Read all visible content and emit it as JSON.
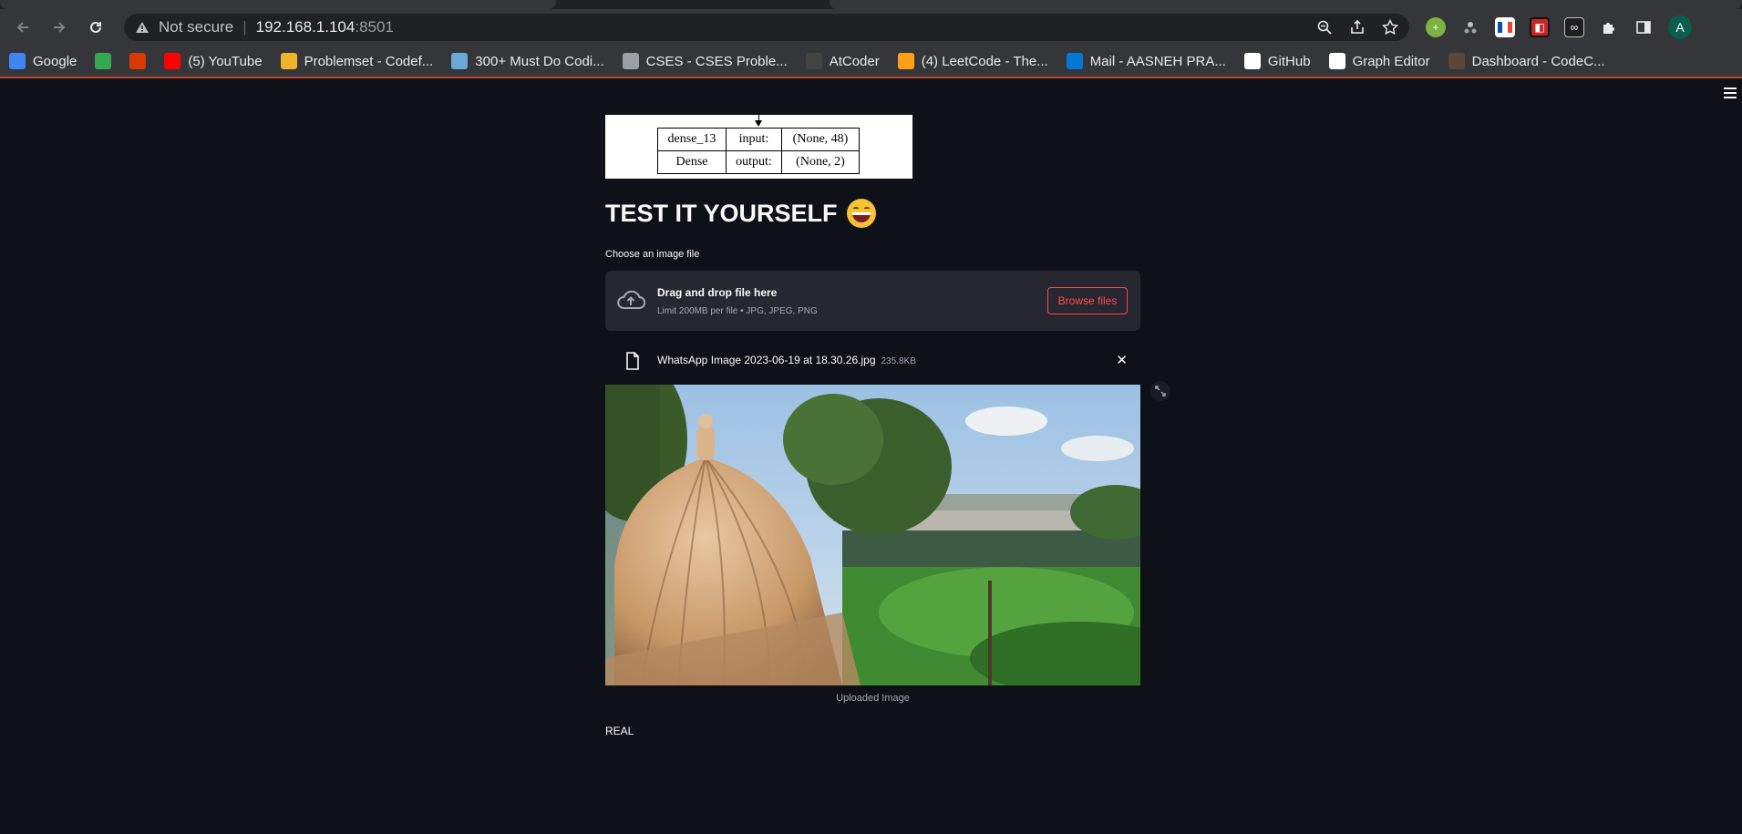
{
  "browser": {
    "security_label": "Not secure",
    "url_host": "192.168.1.104",
    "url_port": ":8501",
    "profile_initial": "A"
  },
  "bookmarks": [
    {
      "label": "Google",
      "icon": "google-icon",
      "color": "#4285f4"
    },
    {
      "label": "",
      "icon": "drive-icon",
      "color": "#34a853"
    },
    {
      "label": "",
      "icon": "office-icon",
      "color": "#d83b01"
    },
    {
      "label": "(5) YouTube",
      "icon": "youtube-icon",
      "color": "#ff0000"
    },
    {
      "label": "Problemset - Codef...",
      "icon": "codeforces-icon",
      "color": "#f0b429"
    },
    {
      "label": "300+ Must Do Codi...",
      "icon": "mountain-icon",
      "color": "#6aa9d8"
    },
    {
      "label": "CSES - CSES Proble...",
      "icon": "globe-icon",
      "color": "#9aa0a6"
    },
    {
      "label": "AtCoder",
      "icon": "atcoder-icon",
      "color": "#444444"
    },
    {
      "label": "(4) LeetCode - The...",
      "icon": "leetcode-icon",
      "color": "#ffa116"
    },
    {
      "label": "Mail - AASNEH PRA...",
      "icon": "outlook-icon",
      "color": "#0078d4"
    },
    {
      "label": "GitHub",
      "icon": "github-icon",
      "color": "#ffffff"
    },
    {
      "label": "Graph Editor",
      "icon": "graph-icon",
      "color": "#ffffff"
    },
    {
      "label": "Dashboard - CodeC...",
      "icon": "codechef-icon",
      "color": "#5b4638"
    }
  ],
  "model": {
    "layer_name": "dense_13",
    "layer_type": "Dense",
    "input_label": "input:",
    "output_label": "output:",
    "input_shape": "(None, 48)",
    "output_shape": "(None, 2)"
  },
  "main": {
    "title": "TEST IT YOURSELF",
    "uploader_label": "Choose an image file",
    "dropzone_title": "Drag and drop file here",
    "dropzone_limit": "Limit 200MB per file • JPG, JPEG, PNG",
    "browse_label": "Browse files",
    "file_name": "WhatsApp Image 2023-06-19 at 18.30.26.jpg",
    "file_size": "235.8KB",
    "image_caption": "Uploaded Image",
    "result": "REAL"
  },
  "colors": {
    "background": "#0e1117",
    "accent": "#ff4b4b",
    "panel": "#262730"
  }
}
